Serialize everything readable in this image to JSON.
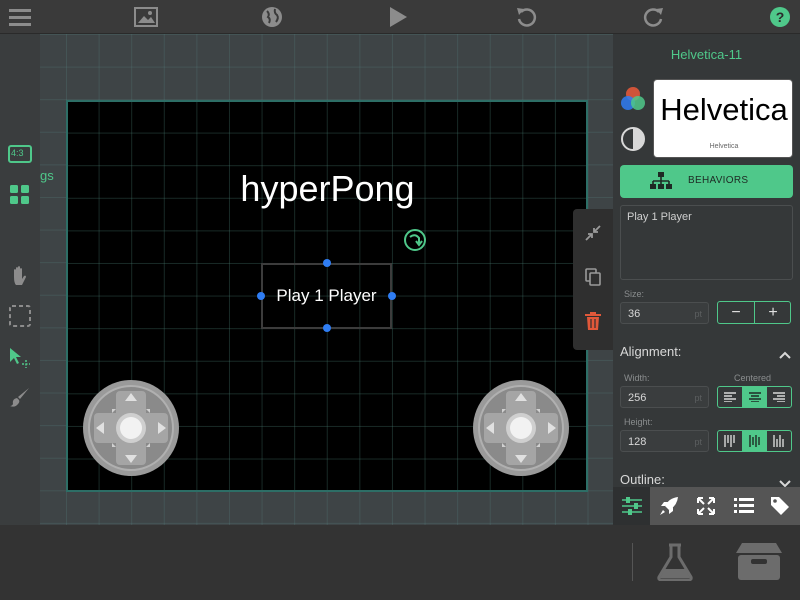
{
  "toolbar": {
    "menu_icon": "hamburger-menu-icon",
    "image_icon": "image-icon",
    "globe_icon": "globe-icon",
    "play_icon": "play-icon",
    "undo_icon": "undo-icon",
    "redo_icon": "redo-icon",
    "help_icon": "help-icon"
  },
  "left_tools": [
    {
      "name": "aspect-ratio",
      "label": "4:3"
    },
    {
      "name": "grid-view-icon"
    },
    {
      "name": "hand-pan-icon"
    },
    {
      "name": "marquee-select-icon"
    },
    {
      "name": "pointer-select-icon"
    },
    {
      "name": "paintbrush-icon"
    }
  ],
  "stage": {
    "partial_label": "gs",
    "title": "hyperPong",
    "selected_text": "Play 1 Player"
  },
  "mini_toolbar": [
    "collapse-icon",
    "duplicate-icon",
    "trash-icon"
  ],
  "panel": {
    "font_name": "Helvetica-11",
    "preview_main": "Helvetica",
    "preview_sub": "Helvetica",
    "behaviors_label": "BEHAVIORS",
    "text_value": "Play 1 Player",
    "size_label": "Size:",
    "size_value": "36",
    "unit": "pt",
    "alignment_label": "Alignment:",
    "width_label": "Width:",
    "width_value": "256",
    "centered_label": "Centered",
    "height_label": "Height:",
    "height_value": "128",
    "outline_label": "Outline:"
  },
  "panel_tabs": [
    "sliders-icon",
    "rocket-icon",
    "expand-icon",
    "list-icon",
    "tags-icon"
  ],
  "bottom": [
    "flask-icon",
    "archive-box-icon"
  ],
  "colors": {
    "accent": "#4fc88a",
    "handle": "#2f7df3",
    "delete": "#e0583a"
  }
}
